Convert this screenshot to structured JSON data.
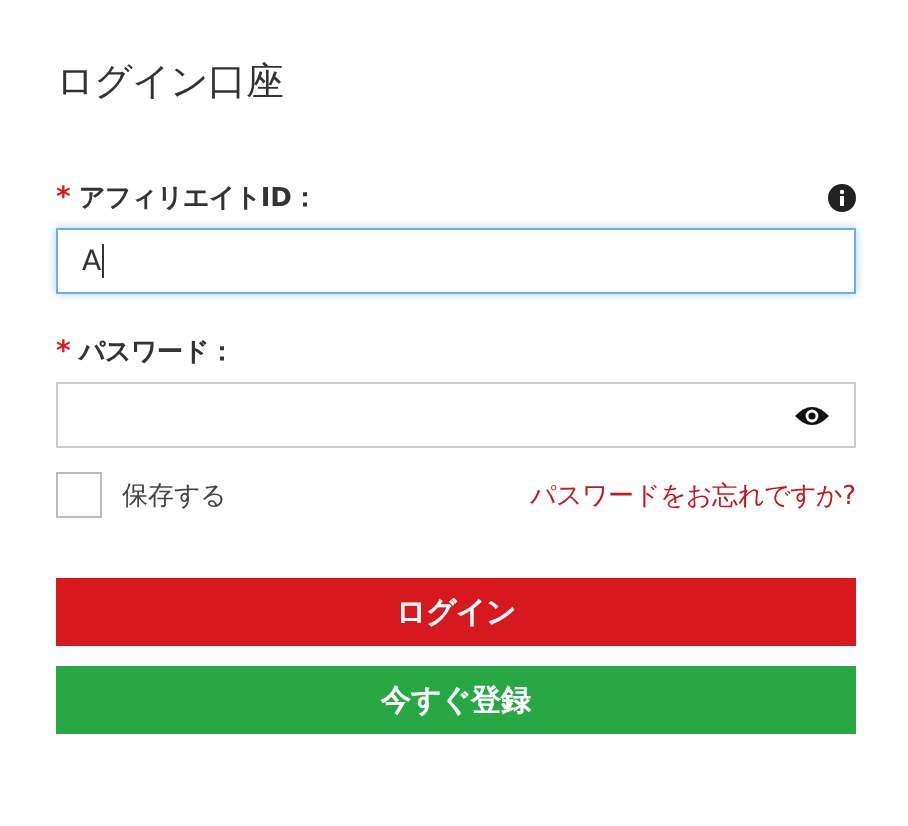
{
  "title": "ログイン口座",
  "fields": [
    {
      "kind": "text",
      "label": "アフィリエイトID：",
      "required_mark": "*",
      "value": "A",
      "focused": true,
      "info": true
    },
    {
      "kind": "password",
      "label": "パスワード：",
      "required_mark": "*",
      "focused": false,
      "info": false
    }
  ],
  "remember": {
    "label": "保存する",
    "checked": false
  },
  "forgot_link": "パスワードをお忘れですか?",
  "buttons": [
    {
      "label": "ログイン",
      "kind": "primary"
    },
    {
      "label": "今すぐ登録",
      "kind": "success"
    }
  ]
}
